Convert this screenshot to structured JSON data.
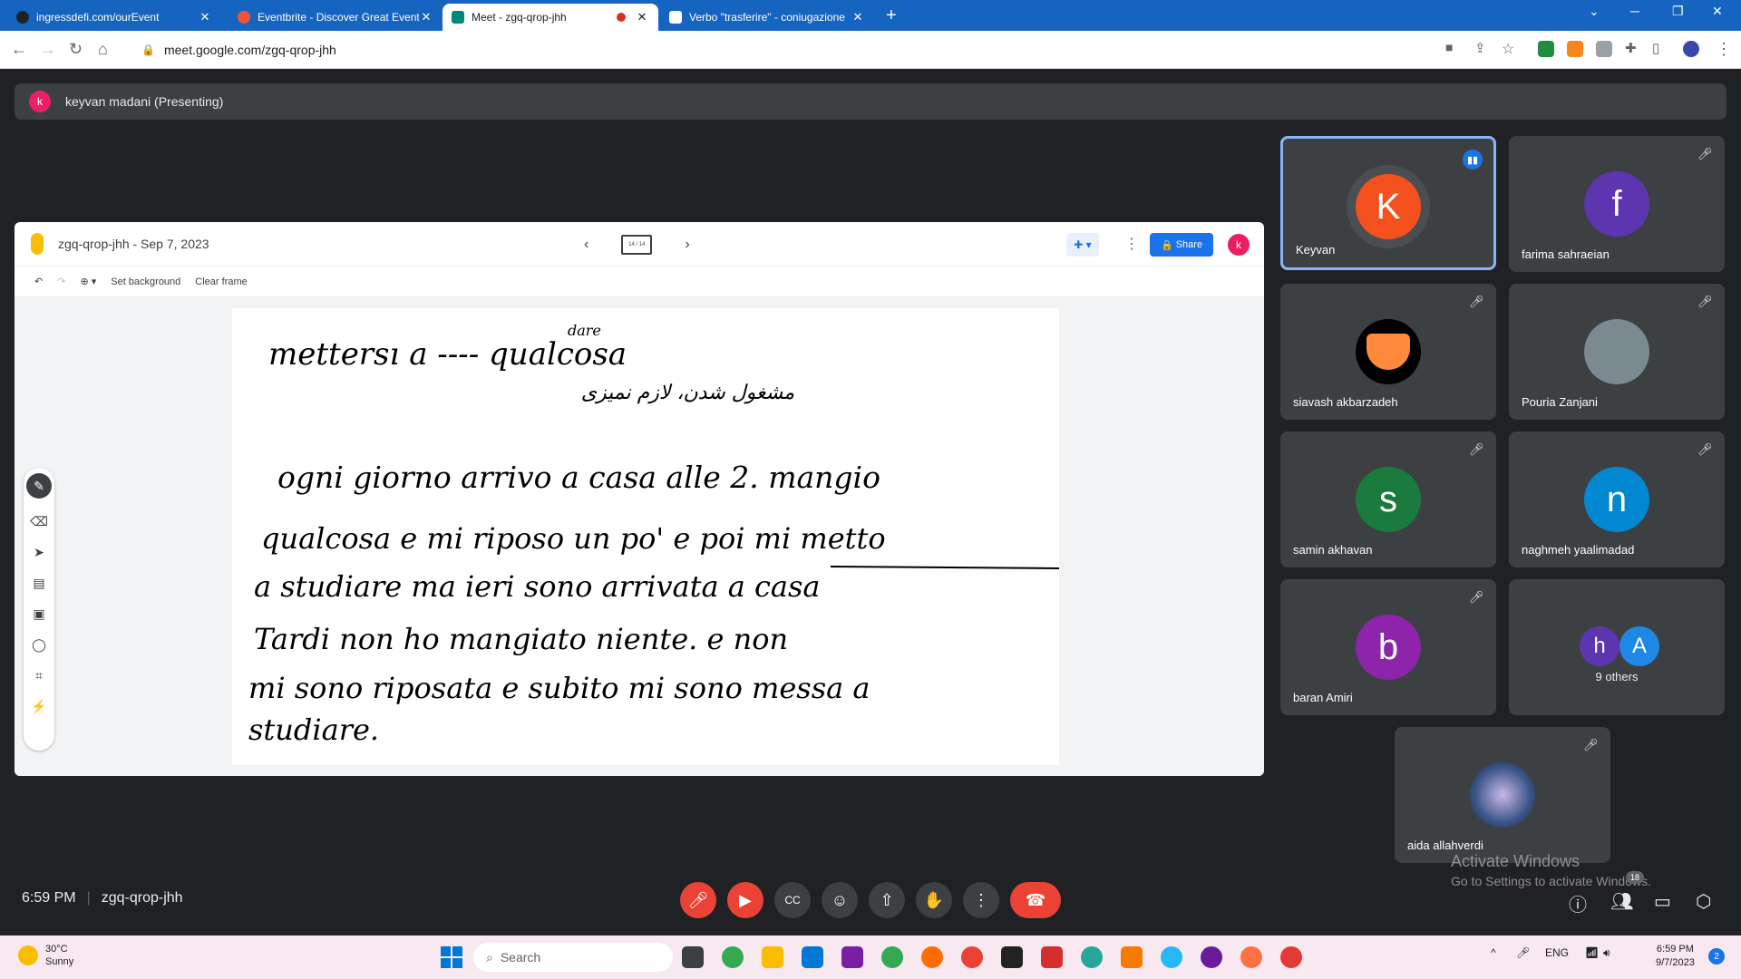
{
  "browser": {
    "tabs": [
      {
        "title": "ingressdefi.com/ourEvent",
        "fav_color": "#202124",
        "active": false
      },
      {
        "title": "Eventbrite - Discover Great Event",
        "fav_color": "#f05537",
        "active": false
      },
      {
        "title": "Meet - zgq-qrop-jhh",
        "fav_color": "#00897b",
        "active": true
      },
      {
        "title": "Verbo \"trasferire\" - coniugazione",
        "fav_color": "#1565c0",
        "active": false
      }
    ],
    "url": "meet.google.com/zgq-qrop-jhh"
  },
  "meet": {
    "presenter_initial": "k",
    "presenter_label": "keyvan madani (Presenting)",
    "meeting_time": "6:59 PM",
    "meeting_code": "zgq-qrop-jhh",
    "participants": [
      {
        "name": "Keyvan",
        "initial": "K",
        "color": "#f4511e",
        "speaking": true
      },
      {
        "name": "farima sahraeian",
        "initial": "f",
        "color": "#5e35b1"
      },
      {
        "name": "siavash akbarzadeh",
        "initial": "",
        "color": "#000000"
      },
      {
        "name": "Pouria Zanjani",
        "initial": "",
        "color": "#7a8a90"
      },
      {
        "name": "samin akhavan",
        "initial": "s",
        "color": "#1b7a3e"
      },
      {
        "name": "naghmeh yaalimadad",
        "initial": "n",
        "color": "#0288d1"
      },
      {
        "name": "baran Amiri",
        "initial": "b",
        "color": "#8e24aa"
      },
      {
        "name": "aida allahverdi",
        "initial": "",
        "color": "#3a5588"
      }
    ],
    "others": {
      "label": "9 others",
      "initials": [
        "h",
        "A"
      ],
      "colors": [
        "#5e35b1",
        "#1e88e5"
      ]
    },
    "people_badge": "18"
  },
  "jamboard": {
    "title": "zgq-qrop-jhh - Sep 7, 2023",
    "frame_indicator": "14 / 14",
    "share_label": "Share",
    "avatar_initial": "k",
    "set_background": "Set background",
    "clear_frame": "Clear frame",
    "handwriting": [
      "mettersı  a  ----  qualcosa",
      "ogni giorno arrivo a casa alle 2. mangio",
      "qualcosa e mi riposo un po' e poi mi metto",
      "a studiare  ma ieri  sono arrivata a casa",
      "Tardi  non ho mangiato niente. e non",
      "mi sono riposata e subito mi sono messa a",
      "studiare."
    ],
    "annotation_top": "dare",
    "annotation_persian": "مشغول شدن، لازم نمیزی"
  },
  "watermark": {
    "line1": "Activate Windows",
    "line2": "Go to Settings to activate Windows."
  },
  "taskbar": {
    "temp": "30°C",
    "weather": "Sunny",
    "search_placeholder": "Search",
    "lang": "ENG",
    "time": "6:59 PM",
    "date": "9/7/2023",
    "notif_count": "2"
  }
}
